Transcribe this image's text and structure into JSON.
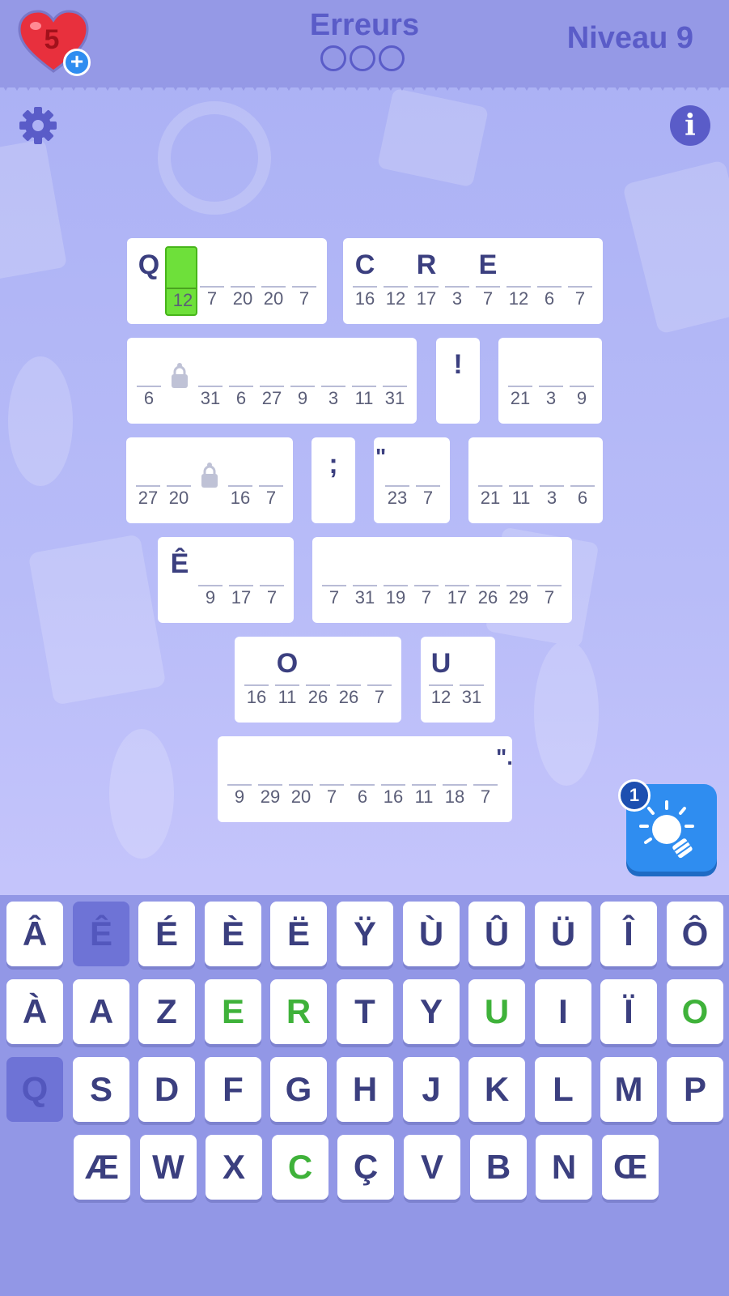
{
  "header": {
    "lives": "5",
    "lives_plus": "+",
    "errors_label": "Erreurs",
    "errors_made": 0,
    "errors_max": 3,
    "level_label": "Niveau 9"
  },
  "hint": {
    "count": "1"
  },
  "puzzle": {
    "cards": [
      {
        "cells": [
          {
            "letter": "Q",
            "num": ""
          },
          {
            "letter": "",
            "num": "12",
            "active": true
          },
          {
            "letter": "",
            "num": "7"
          },
          {
            "letter": "",
            "num": "20"
          },
          {
            "letter": "",
            "num": "20"
          },
          {
            "letter": "",
            "num": "7"
          }
        ]
      },
      {
        "cells": [
          {
            "letter": "C",
            "num": "16"
          },
          {
            "letter": "",
            "num": "12"
          },
          {
            "letter": "R",
            "num": "17"
          },
          {
            "letter": "",
            "num": "3"
          },
          {
            "letter": "E",
            "num": "7"
          },
          {
            "letter": "",
            "num": "12"
          },
          {
            "letter": "",
            "num": "6"
          },
          {
            "letter": "",
            "num": "7"
          }
        ]
      },
      {
        "cells": [
          {
            "letter": "",
            "num": "6"
          },
          {
            "letter": "",
            "num": "",
            "locked": true
          },
          {
            "letter": "",
            "num": "31"
          },
          {
            "letter": "",
            "num": "6"
          },
          {
            "letter": "",
            "num": "27"
          },
          {
            "letter": "",
            "num": "9"
          },
          {
            "letter": "",
            "num": "3"
          },
          {
            "letter": "",
            "num": "11"
          },
          {
            "letter": "",
            "num": "31"
          }
        ]
      },
      {
        "punct": "!"
      },
      {
        "cells": [
          {
            "letter": "",
            "num": "21"
          },
          {
            "letter": "",
            "num": "3"
          },
          {
            "letter": "",
            "num": "9"
          }
        ]
      },
      {
        "cells": [
          {
            "letter": "",
            "num": "27"
          },
          {
            "letter": "",
            "num": "20"
          },
          {
            "letter": "",
            "num": "",
            "locked": true
          },
          {
            "letter": "",
            "num": "16"
          },
          {
            "letter": "",
            "num": "7"
          }
        ]
      },
      {
        "punct": ";"
      },
      {
        "prefix": "\"",
        "cells": [
          {
            "letter": "",
            "num": "23"
          },
          {
            "letter": "",
            "num": "7"
          }
        ]
      },
      {
        "cells": [
          {
            "letter": "",
            "num": "21"
          },
          {
            "letter": "",
            "num": "11"
          },
          {
            "letter": "",
            "num": "3"
          },
          {
            "letter": "",
            "num": "6"
          }
        ]
      },
      {
        "cells": [
          {
            "letter": "Ê",
            "num": ""
          },
          {
            "letter": "",
            "num": "9"
          },
          {
            "letter": "",
            "num": "17"
          },
          {
            "letter": "",
            "num": "7"
          }
        ]
      },
      {
        "cells": [
          {
            "letter": "",
            "num": "7"
          },
          {
            "letter": "",
            "num": "31"
          },
          {
            "letter": "",
            "num": "19"
          },
          {
            "letter": "",
            "num": "7"
          },
          {
            "letter": "",
            "num": "17"
          },
          {
            "letter": "",
            "num": "26"
          },
          {
            "letter": "",
            "num": "29"
          },
          {
            "letter": "",
            "num": "7"
          }
        ]
      },
      {
        "cells": [
          {
            "letter": "",
            "num": "16"
          },
          {
            "letter": "O",
            "num": "11"
          },
          {
            "letter": "",
            "num": "26"
          },
          {
            "letter": "",
            "num": "26"
          },
          {
            "letter": "",
            "num": "7"
          }
        ]
      },
      {
        "cells": [
          {
            "letter": "U",
            "num": "12"
          },
          {
            "letter": "",
            "num": "31"
          }
        ]
      },
      {
        "suffix": "\".",
        "cells": [
          {
            "letter": "",
            "num": "9"
          },
          {
            "letter": "",
            "num": "29"
          },
          {
            "letter": "",
            "num": "20"
          },
          {
            "letter": "",
            "num": "7"
          },
          {
            "letter": "",
            "num": "6"
          },
          {
            "letter": "",
            "num": "16"
          },
          {
            "letter": "",
            "num": "11"
          },
          {
            "letter": "",
            "num": "18"
          },
          {
            "letter": "",
            "num": "7"
          }
        ]
      }
    ]
  },
  "keyboard": {
    "rows": [
      [
        {
          "label": "Â"
        },
        {
          "label": "Ê",
          "state": "used"
        },
        {
          "label": "É"
        },
        {
          "label": "È"
        },
        {
          "label": "Ë"
        },
        {
          "label": "Ÿ"
        },
        {
          "label": "Ù"
        },
        {
          "label": "Û"
        },
        {
          "label": "Ü"
        },
        {
          "label": "Î"
        },
        {
          "label": "Ô"
        }
      ],
      [
        {
          "label": "À"
        },
        {
          "label": "A"
        },
        {
          "label": "Z"
        },
        {
          "label": "E",
          "state": "solved"
        },
        {
          "label": "R",
          "state": "solved"
        },
        {
          "label": "T"
        },
        {
          "label": "Y"
        },
        {
          "label": "U",
          "state": "solved"
        },
        {
          "label": "I"
        },
        {
          "label": "Ï"
        },
        {
          "label": "O",
          "state": "solved"
        }
      ],
      [
        {
          "label": "Q",
          "state": "used"
        },
        {
          "label": "S"
        },
        {
          "label": "D"
        },
        {
          "label": "F"
        },
        {
          "label": "G"
        },
        {
          "label": "H"
        },
        {
          "label": "J"
        },
        {
          "label": "K"
        },
        {
          "label": "L"
        },
        {
          "label": "M"
        },
        {
          "label": "P"
        }
      ],
      [
        {
          "label": "Æ"
        },
        {
          "label": "W"
        },
        {
          "label": "X"
        },
        {
          "label": "C",
          "state": "solved"
        },
        {
          "label": "Ç"
        },
        {
          "label": "V"
        },
        {
          "label": "B"
        },
        {
          "label": "N"
        },
        {
          "label": "Œ"
        }
      ]
    ]
  }
}
